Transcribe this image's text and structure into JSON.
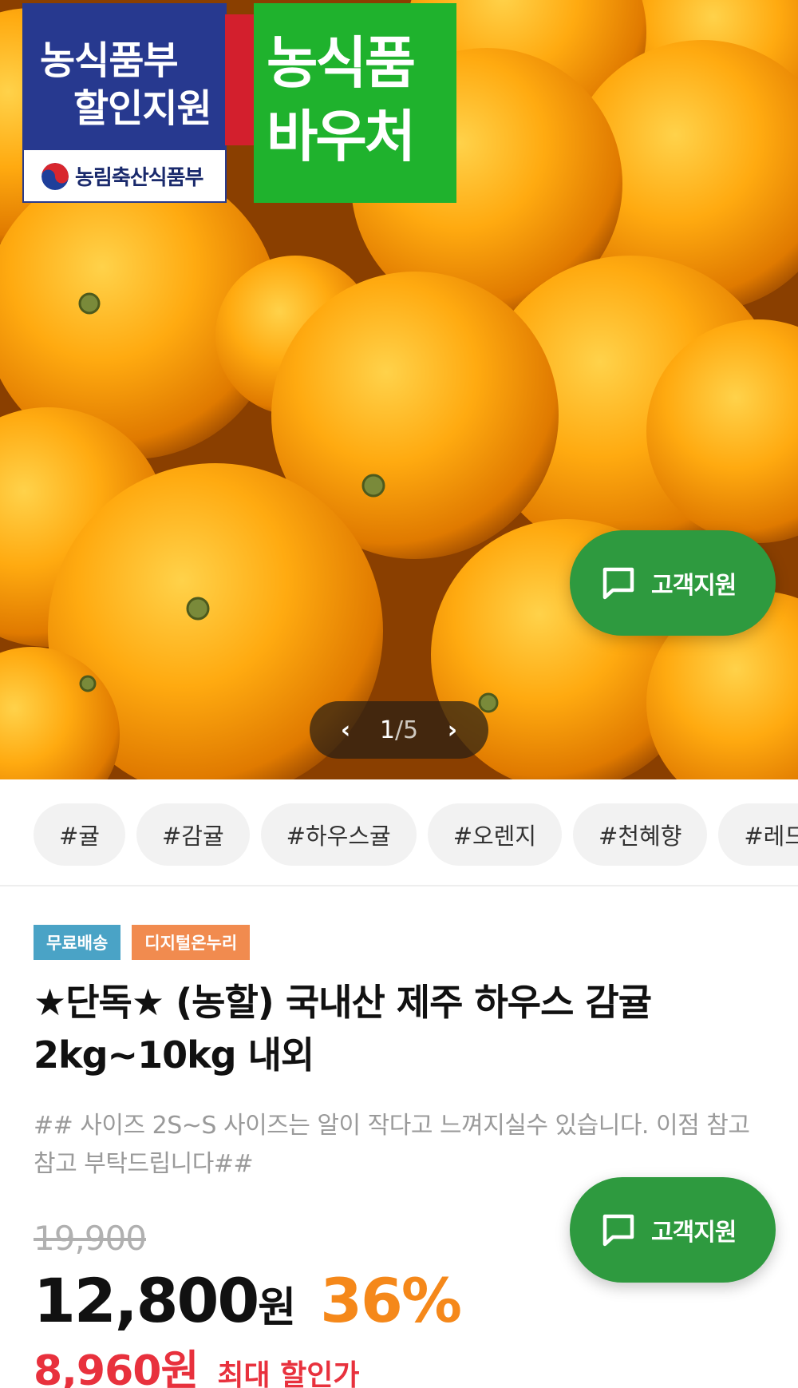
{
  "hero": {
    "badge_blue_line1": "농식품부",
    "badge_blue_line2": "할인지원",
    "ministry": "농림축산식품부",
    "badge_green_line1": "농식품",
    "badge_green_line2": "바우처",
    "pager_current": "1",
    "pager_rest": "/5",
    "prev_icon": "chevron-left-icon",
    "next_icon": "chevron-right-icon"
  },
  "support_button": {
    "label": "고객지원",
    "icon": "chat-bubble-icon",
    "color": "#2e9a3f"
  },
  "tags": [
    "#귤",
    "#감귤",
    "#하우스귤",
    "#오렌지",
    "#천혜향",
    "#레드향"
  ],
  "labels": {
    "free_shipping": "무료배송",
    "onnuri": "디지털온누리"
  },
  "product": {
    "title": "★단독★ (농할) 국내산 제주 하우스 감귤 2kg~10kg 내외",
    "description": "## 사이즈 2S~S 사이즈는 알이 작다고 느껴지실수 있습니다. 이점 참고 참고 부탁드립니다##"
  },
  "pricing": {
    "original": "19,900",
    "price": "12,800",
    "won": "원",
    "discount": "36%",
    "max_price": "8,960원",
    "max_label": "최대 할인가",
    "accent_orange": "#f5881a",
    "accent_red": "#e8313d"
  }
}
